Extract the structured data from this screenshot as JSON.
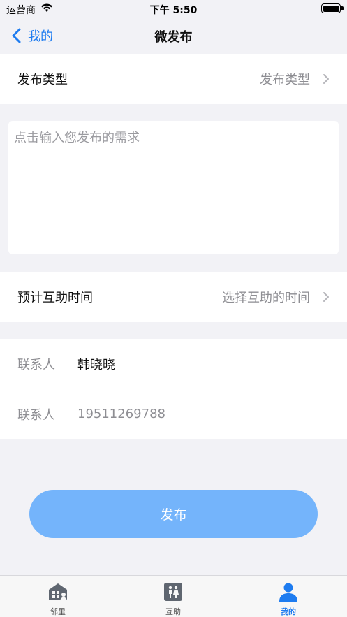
{
  "status_bar": {
    "carrier": "运营商",
    "time": "下午 5:50"
  },
  "nav": {
    "back_label": "我的",
    "title": "微发布"
  },
  "type_row": {
    "label": "发布类型",
    "value": "发布类型"
  },
  "content": {
    "placeholder": "点击输入您发布的需求"
  },
  "time_row": {
    "label": "预计互助时间",
    "value": "选择互助的时间"
  },
  "contacts": [
    {
      "label": "联系人",
      "value": "韩晓晓"
    },
    {
      "label": "联系人",
      "value": "19511269788"
    }
  ],
  "publish": {
    "label": "发布"
  },
  "tabs": [
    {
      "label": "邻里",
      "icon": "building-icon",
      "active": false
    },
    {
      "label": "互助",
      "icon": "people-icon",
      "active": false
    },
    {
      "label": "我的",
      "icon": "person-icon",
      "active": true
    }
  ],
  "colors": {
    "accent": "#1e7cf0",
    "button": "#74b4fb",
    "background": "#f2f2f6"
  }
}
